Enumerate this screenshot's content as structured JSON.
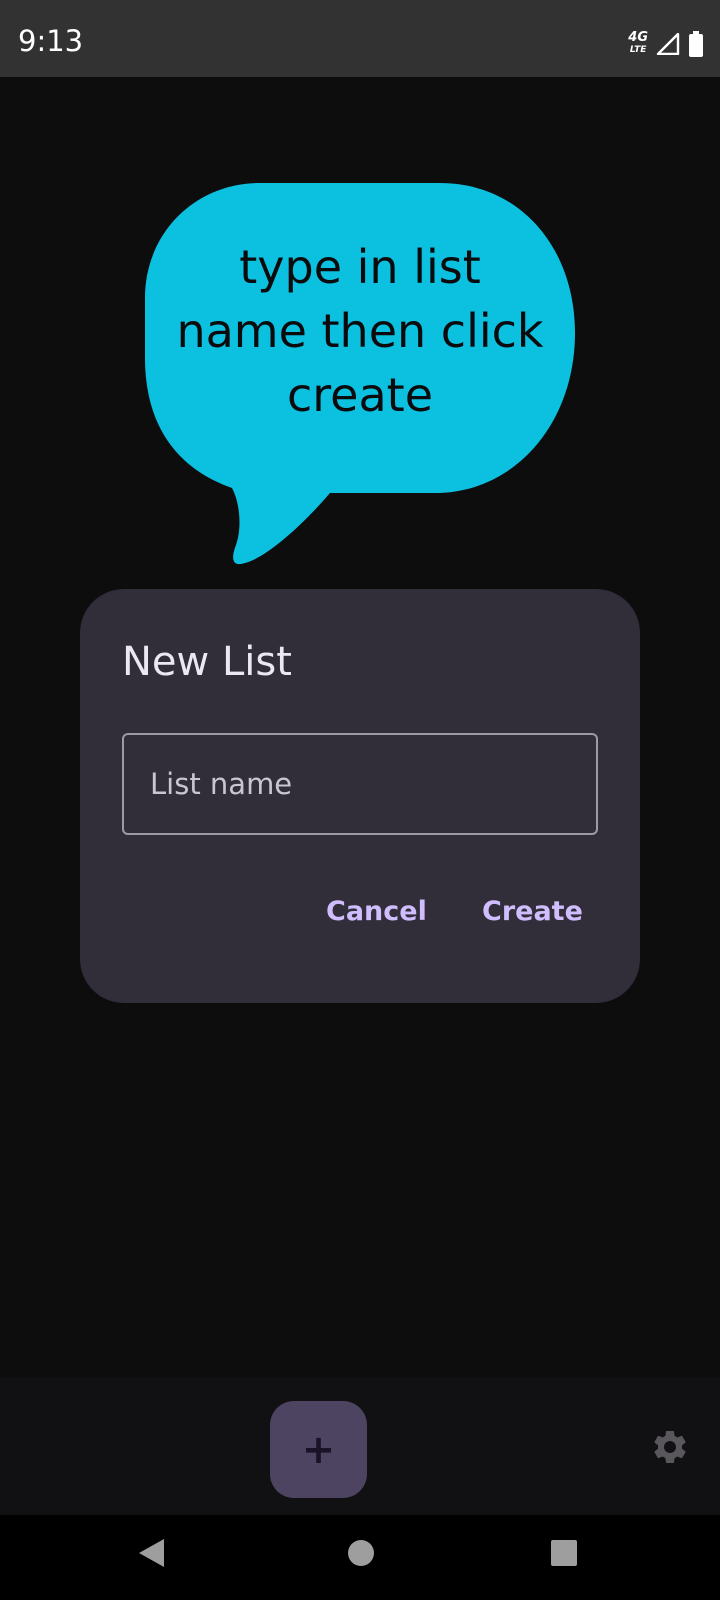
{
  "status_bar": {
    "time": "9:13",
    "network_label": "4G",
    "network_sub": "LTE"
  },
  "tooltip": {
    "text": "type in list name then click create",
    "color": "#0cc0e0"
  },
  "dialog": {
    "title": "New List",
    "input_placeholder": "List name",
    "input_value": "",
    "cancel_label": "Cancel",
    "create_label": "Create",
    "accent_color": "#cfbdfe"
  },
  "bottom_bar": {
    "fab_icon": "+",
    "settings_icon": "gear-icon"
  },
  "nav_bar": {
    "icons": [
      "back-icon",
      "home-icon",
      "recents-icon"
    ]
  }
}
